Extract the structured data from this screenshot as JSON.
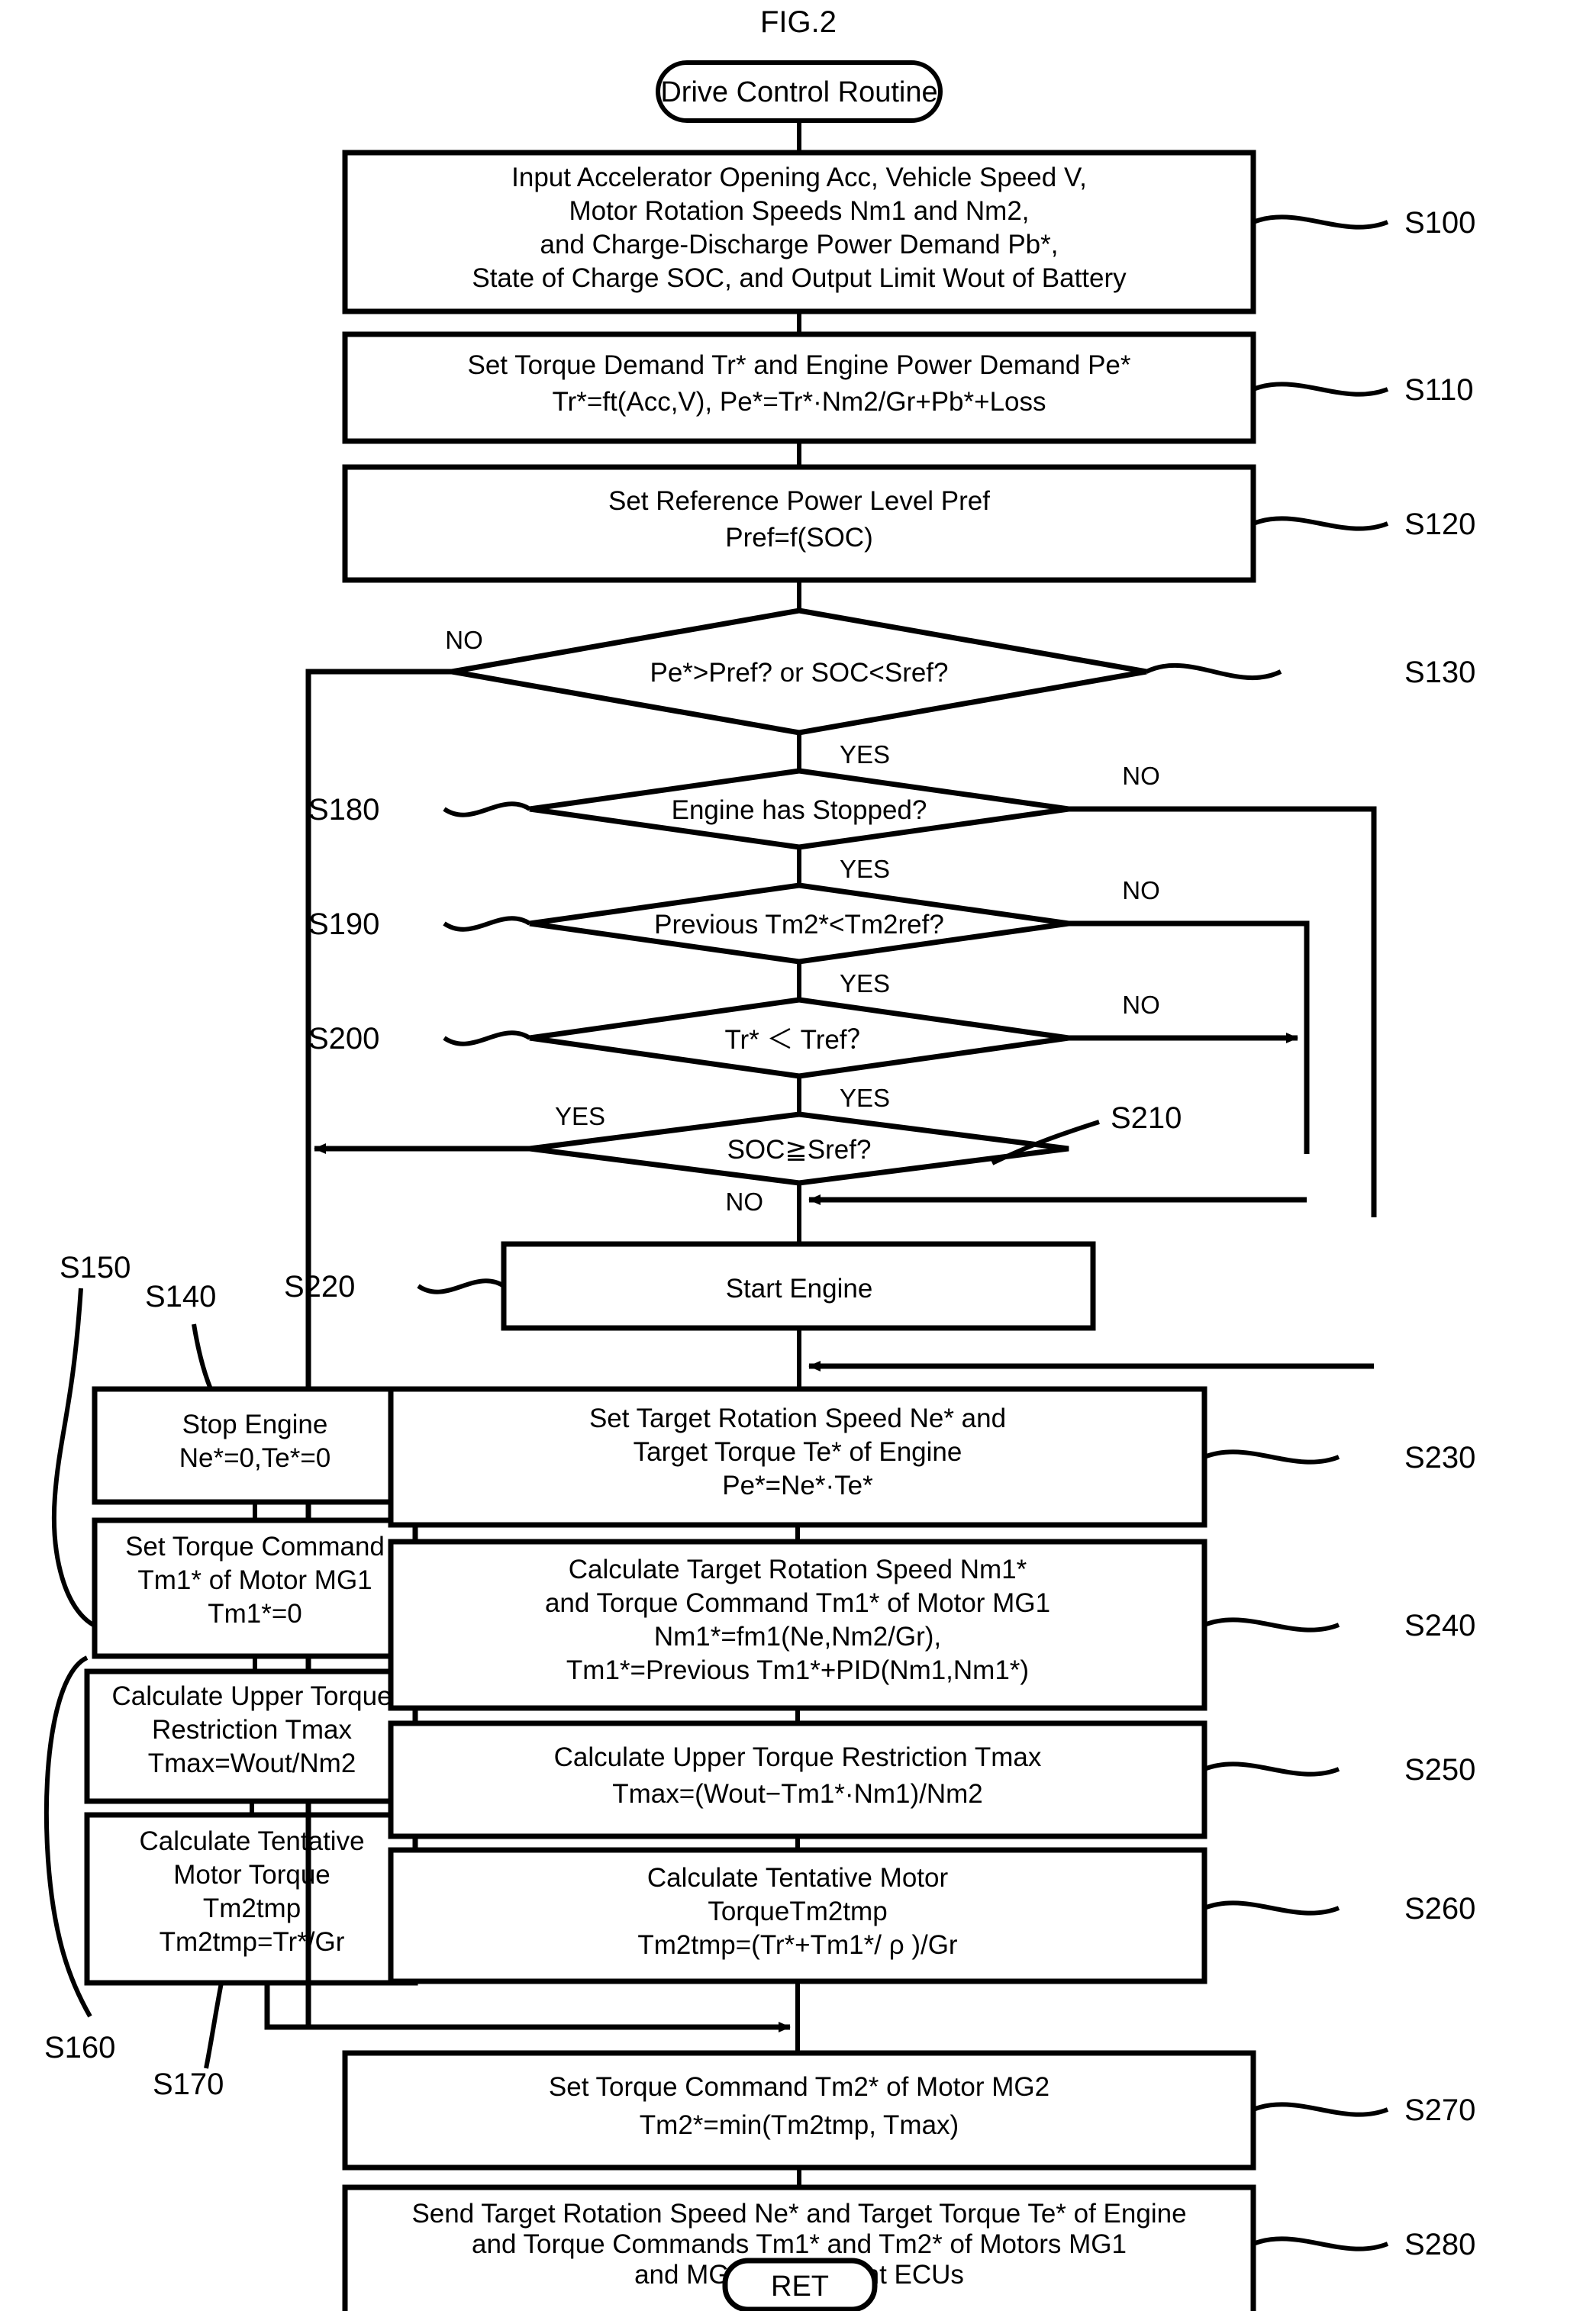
{
  "figure": {
    "title": "FIG.2"
  },
  "terminals": {
    "start": "Drive Control Routine",
    "end": "RET"
  },
  "branch_labels": {
    "yes": "YES",
    "no": "NO"
  },
  "steps": [
    {
      "id": "S100",
      "ref": "S100",
      "shape": "process",
      "lines": [
        "Input Accelerator Opening Acc, Vehicle Speed V,",
        "Motor Rotation Speeds Nm1 and Nm2,",
        "and Charge-Discharge Power Demand Pb*,",
        "State of Charge SOC, and Output Limit Wout of Battery"
      ]
    },
    {
      "id": "S110",
      "ref": "S110",
      "shape": "process",
      "lines": [
        "Set Torque Demand Tr* and Engine Power Demand Pe*",
        "Tr*=ft(Acc,V),  Pe*=Tr*·Nm2/Gr+Pb*+Loss"
      ]
    },
    {
      "id": "S120",
      "ref": "S120",
      "shape": "process",
      "lines": [
        "Set Reference Power Level Pref",
        "Pref=f(SOC)"
      ]
    },
    {
      "id": "S130",
      "ref": "S130",
      "shape": "decision",
      "lines": [
        "Pe*>Pref? or SOC<Sref?"
      ],
      "yes": "YES",
      "no": "NO"
    },
    {
      "id": "S180",
      "ref": "S180",
      "shape": "decision",
      "lines": [
        "Engine has Stopped?"
      ],
      "yes": "YES",
      "no": "NO"
    },
    {
      "id": "S190",
      "ref": "S190",
      "shape": "decision",
      "lines": [
        "Previous Tm2*<Tm2ref?"
      ],
      "yes": "YES",
      "no": "NO"
    },
    {
      "id": "S200",
      "ref": "S200",
      "shape": "decision",
      "lines": [
        "Tr* ＜ Tref？"
      ],
      "yes": "YES",
      "no": "NO"
    },
    {
      "id": "S210",
      "ref": "S210",
      "shape": "decision",
      "lines": [
        "SOC≧Sref?"
      ],
      "yes": "YES",
      "no": "NO"
    },
    {
      "id": "S220",
      "ref": "S220",
      "shape": "process",
      "lines": [
        "Start Engine"
      ]
    },
    {
      "id": "S140",
      "ref": "S140",
      "shape": "process",
      "lines": [
        "Stop Engine",
        "Ne*=0,Te*=0"
      ]
    },
    {
      "id": "S150",
      "ref": "S150",
      "shape": "process",
      "lines": [
        "Set Torque Command",
        "Tm1* of Motor MG1",
        "Tm1*=0"
      ]
    },
    {
      "id": "S160",
      "ref": "S160",
      "shape": "process",
      "lines": [
        "Calculate Upper Torque",
        "Restriction Tmax",
        "Tmax=Wout/Nm2"
      ]
    },
    {
      "id": "S170",
      "ref": "S170",
      "shape": "process",
      "lines": [
        "Calculate Tentative",
        "Motor Torque",
        "Tm2tmp",
        "Tm2tmp=Tr*/Gr"
      ]
    },
    {
      "id": "S230",
      "ref": "S230",
      "shape": "process",
      "lines": [
        "Set Target Rotation Speed Ne* and",
        "Target Torque Te* of Engine",
        "Pe*=Ne*·Te*"
      ]
    },
    {
      "id": "S240",
      "ref": "S240",
      "shape": "process",
      "lines": [
        "Calculate Target Rotation Speed Nm1*",
        "and Torque Command Tm1* of Motor MG1",
        "Nm1*=fm1(Ne,Nm2/Gr),",
        "Tm1*=Previous Tm1*+PID(Nm1,Nm1*)"
      ]
    },
    {
      "id": "S250",
      "ref": "S250",
      "shape": "process",
      "lines": [
        "Calculate Upper Torque Restriction Tmax",
        "Tmax=(Wout−Tm1*·Nm1)/Nm2"
      ]
    },
    {
      "id": "S260",
      "ref": "S260",
      "shape": "process",
      "lines": [
        "Calculate Tentative Motor",
        "TorqueTm2tmp",
        "Tm2tmp=(Tr*+Tm1*/ ρ )/Gr"
      ]
    },
    {
      "id": "S270",
      "ref": "S270",
      "shape": "process",
      "lines": [
        "Set Torque Command Tm2* of Motor MG2",
        "Tm2*=min(Tm2tmp, Tmax)"
      ]
    },
    {
      "id": "S280",
      "ref": "S280",
      "shape": "process",
      "lines": [
        "Send Target Rotation Speed Ne* and Target Torque Te* of Engine",
        "and Torque Commands Tm1* and Tm2* of Motors MG1",
        "and MG2 to Relevant ECUs"
      ]
    }
  ],
  "colors": {
    "ink": "#000000",
    "paper": "#ffffff"
  }
}
